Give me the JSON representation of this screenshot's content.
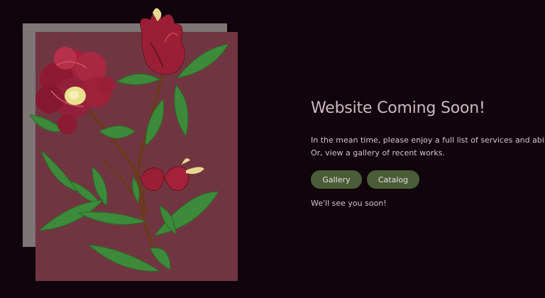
{
  "main": {
    "headline": "Website Coming Soon!",
    "intro_line1": "In the mean time, please enjoy a full list of services and abilities.",
    "intro_line2": "Or, view a gallery of recent works.",
    "buttons": {
      "gallery_label": "Gallery",
      "catalog_label": "Catalog"
    },
    "closing": "We'll see you soon!"
  },
  "artwork": {
    "subject": "painted-flower-icon"
  },
  "colors": {
    "background": "#10050c",
    "accent_button": "#4b5d38",
    "card_back": "#7d7576",
    "card_front": "#713542",
    "heading_text": "#cdb9c2"
  }
}
